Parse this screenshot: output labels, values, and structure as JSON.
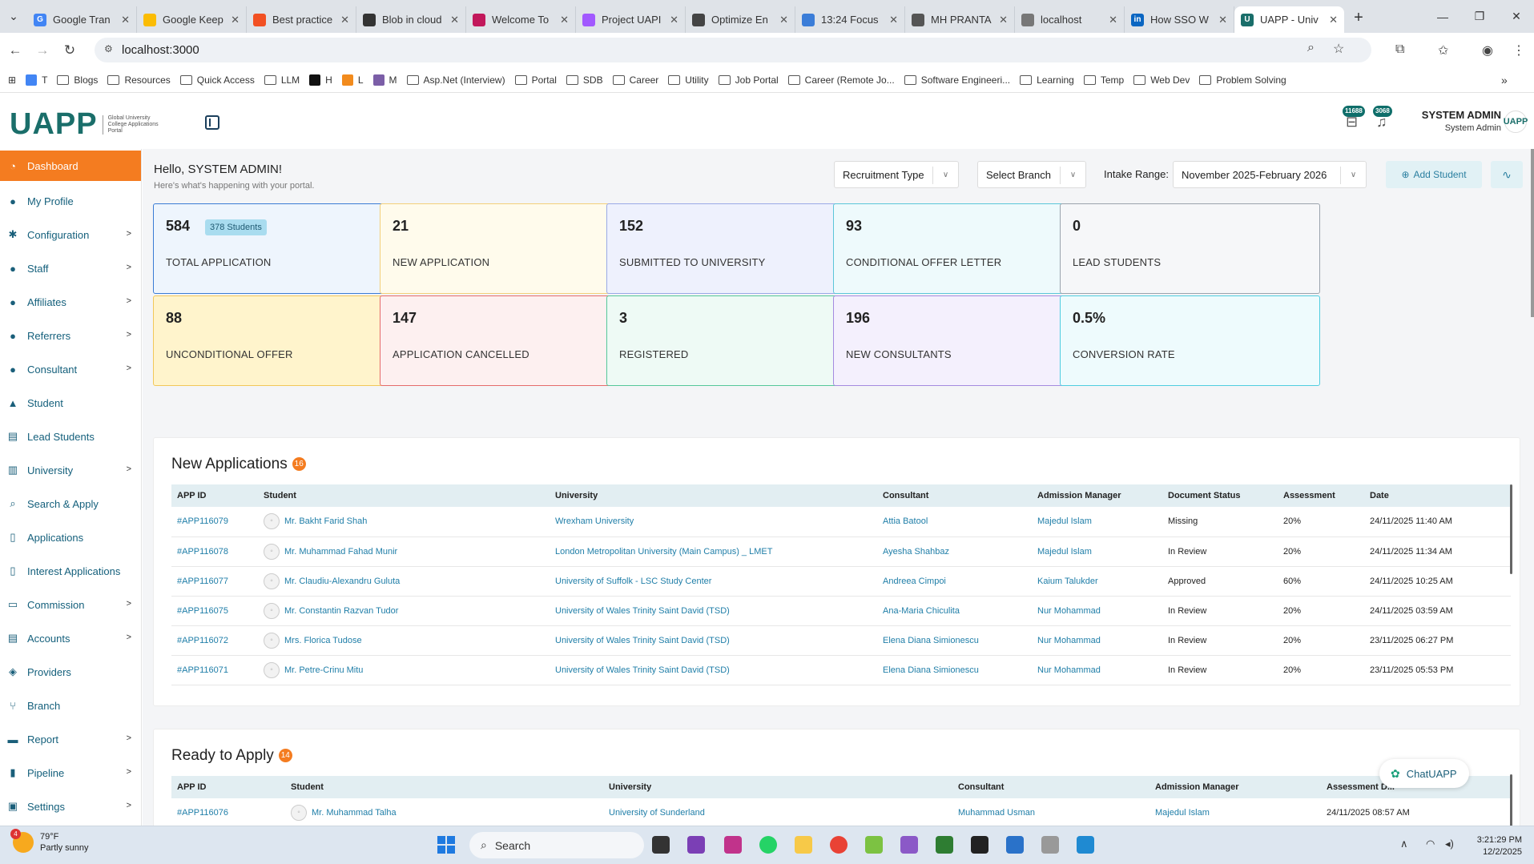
{
  "browser": {
    "tabs": [
      {
        "label": "Google Tran",
        "color": "#4285f4",
        "glyph": "G"
      },
      {
        "label": "Google Keep",
        "color": "#fbbc04",
        "glyph": ""
      },
      {
        "label": "Best practice",
        "color": "#f25022",
        "glyph": ""
      },
      {
        "label": "Blob in cloud",
        "color": "#333333",
        "glyph": ""
      },
      {
        "label": "Welcome To",
        "color": "#c2185b",
        "glyph": ""
      },
      {
        "label": "Project UAPI",
        "color": "#a259ff",
        "glyph": ""
      },
      {
        "label": "Optimize En",
        "color": "#444444",
        "glyph": ""
      },
      {
        "label": "13:24 Focus",
        "color": "#3b7dd8",
        "glyph": ""
      },
      {
        "label": "MH PRANTA",
        "color": "#555555",
        "glyph": ""
      },
      {
        "label": "localhost",
        "color": "#777777",
        "glyph": ""
      },
      {
        "label": "How SSO W",
        "color": "#0a66c2",
        "glyph": "in"
      },
      {
        "label": "UAPP - Univ",
        "color": "#1a6e6a",
        "glyph": "U"
      }
    ],
    "address": "localhost:3000",
    "bookmarks": [
      {
        "label": "T",
        "type": "site",
        "color": "#4285f4"
      },
      {
        "label": "Blogs",
        "type": "folder"
      },
      {
        "label": "Resources",
        "type": "folder"
      },
      {
        "label": "Quick Access",
        "type": "folder"
      },
      {
        "label": "LLM",
        "type": "folder"
      },
      {
        "label": "H",
        "type": "site",
        "color": "#111111"
      },
      {
        "label": "L",
        "type": "site",
        "color": "#f28b1d"
      },
      {
        "label": "M",
        "type": "site",
        "color": "#7b5ea7"
      },
      {
        "label": "Asp.Net (Interview)",
        "type": "folder"
      },
      {
        "label": "Portal",
        "type": "folder"
      },
      {
        "label": "SDB",
        "type": "folder"
      },
      {
        "label": "Career",
        "type": "folder"
      },
      {
        "label": "Utility",
        "type": "folder"
      },
      {
        "label": "Job Portal",
        "type": "folder"
      },
      {
        "label": "Career (Remote Jo...",
        "type": "folder"
      },
      {
        "label": "Software Engineeri...",
        "type": "folder"
      },
      {
        "label": "Learning",
        "type": "folder"
      },
      {
        "label": "Temp",
        "type": "folder"
      },
      {
        "label": "Web Dev",
        "type": "folder"
      },
      {
        "label": "Problem Solving",
        "type": "folder"
      }
    ]
  },
  "header": {
    "logo_text": "UAPP",
    "logo_sub": "Global University College Applications Portal",
    "badge1": "11688",
    "badge2": "3068",
    "user_name": "SYSTEM ADMIN",
    "user_role": "System Admin",
    "avatar_text": "UAPP"
  },
  "sidebar": {
    "items": [
      {
        "label": "Dashboard",
        "icon": "dashboard-icon",
        "glyph": "◔",
        "chevron": false,
        "active": true
      },
      {
        "label": "My Profile",
        "icon": "user-icon",
        "glyph": "●",
        "chevron": false
      },
      {
        "label": "Configuration",
        "icon": "gear-icon",
        "glyph": "✱",
        "chevron": true
      },
      {
        "label": "Staff",
        "icon": "users-icon",
        "glyph": "●",
        "chevron": true
      },
      {
        "label": "Affiliates",
        "icon": "user-plus-icon",
        "glyph": "●",
        "chevron": true
      },
      {
        "label": "Referrers",
        "icon": "user-share-icon",
        "glyph": "●",
        "chevron": true
      },
      {
        "label": "Consultant",
        "icon": "user-tie-icon",
        "glyph": "●",
        "chevron": true
      },
      {
        "label": "Student",
        "icon": "graduation-cap-icon",
        "glyph": "▲",
        "chevron": false
      },
      {
        "label": "Lead Students",
        "icon": "user-list-icon",
        "glyph": "▤",
        "chevron": false
      },
      {
        "label": "University",
        "icon": "university-icon",
        "glyph": "▥",
        "chevron": true
      },
      {
        "label": "Search & Apply",
        "icon": "search-icon",
        "glyph": "⌕",
        "chevron": false
      },
      {
        "label": "Applications",
        "icon": "file-icon",
        "glyph": "▯",
        "chevron": false
      },
      {
        "label": "Interest Applications",
        "icon": "file-icon",
        "glyph": "▯",
        "chevron": false
      },
      {
        "label": "Commission",
        "icon": "money-icon",
        "glyph": "▭",
        "chevron": true
      },
      {
        "label": "Accounts",
        "icon": "accounts-icon",
        "glyph": "▤",
        "chevron": true
      },
      {
        "label": "Providers",
        "icon": "handshake-icon",
        "glyph": "◈",
        "chevron": false
      },
      {
        "label": "Branch",
        "icon": "branch-icon",
        "glyph": "⑂",
        "chevron": false
      },
      {
        "label": "Report",
        "icon": "report-icon",
        "glyph": "▬",
        "chevron": true
      },
      {
        "label": "Pipeline",
        "icon": "bar-chart-icon",
        "glyph": "▮",
        "chevron": true
      },
      {
        "label": "Settings",
        "icon": "settings-icon",
        "glyph": "▣",
        "chevron": true
      }
    ]
  },
  "main": {
    "greeting": "Hello, SYSTEM ADMIN!",
    "greeting_sub": "Here's what's happening with your portal.",
    "filters": {
      "recruitment_type": "Recruitment Type",
      "branch": "Select Branch",
      "intake_label": "Intake Range:",
      "intake_value": "November 2025-February 2026",
      "add_student": "Add Student"
    },
    "stats": [
      {
        "value": "584",
        "label": "TOTAL APPLICATION",
        "badge": "378 Students",
        "bg": "#eef5fd",
        "border": "#3a7bd5"
      },
      {
        "value": "21",
        "label": "NEW APPLICATION",
        "bg": "#fffbec",
        "border": "#f3cf7a"
      },
      {
        "value": "152",
        "label": "SUBMITTED TO UNIVERSITY",
        "bg": "#eef1fd",
        "border": "#9aa9e6"
      },
      {
        "value": "93",
        "label": "CONDITIONAL OFFER LETTER",
        "bg": "#eefafc",
        "border": "#5bc6d9"
      },
      {
        "value": "0",
        "label": "LEAD STUDENTS",
        "bg": "#f6f7f9",
        "border": "#9aa3ad"
      },
      {
        "value": "88",
        "label": "UNCONDITIONAL OFFER",
        "bg": "#fff4cc",
        "border": "#f2c759"
      },
      {
        "value": "147",
        "label": "APPLICATION CANCELLED",
        "bg": "#fdf0f0",
        "border": "#e56b6b"
      },
      {
        "value": "3",
        "label": "REGISTERED",
        "bg": "#eefaf5",
        "border": "#55c79a"
      },
      {
        "value": "196",
        "label": "NEW CONSULTANTS",
        "bg": "#f4f0fd",
        "border": "#a48be0"
      },
      {
        "value": "0.5%",
        "label": "CONVERSION RATE",
        "bg": "#eefbfd",
        "border": "#4fcde0"
      }
    ],
    "new_applications": {
      "title": "New Applications",
      "count": "16",
      "columns": [
        "APP ID",
        "Student",
        "University",
        "Consultant",
        "Admission Manager",
        "Document Status",
        "Assessment",
        "Date"
      ],
      "rows": [
        {
          "id": "#APP116079",
          "student": "Mr. Bakht Farid Shah",
          "university": "Wrexham University",
          "consultant": "Attia Batool",
          "manager": "Majedul Islam",
          "doc": "Missing",
          "assessment": "20%",
          "date": "24/11/2025 11:40 AM"
        },
        {
          "id": "#APP116078",
          "student": "Mr. Muhammad Fahad Munir",
          "university": "London Metropolitan University (Main Campus) _ LMET",
          "consultant": "Ayesha Shahbaz",
          "manager": "Majedul Islam",
          "doc": "In Review",
          "assessment": "20%",
          "date": "24/11/2025 11:34 AM"
        },
        {
          "id": "#APP116077",
          "student": "Mr. Claudiu-Alexandru Guluta",
          "university": "University of Suffolk - LSC Study Center",
          "consultant": "Andreea Cimpoi",
          "manager": "Kaium Talukder",
          "doc": "Approved",
          "assessment": "60%",
          "date": "24/11/2025 10:25 AM"
        },
        {
          "id": "#APP116075",
          "student": "Mr. Constantin Razvan Tudor",
          "university": "University of Wales Trinity Saint David (TSD)",
          "consultant": "Ana-Maria Chiculita",
          "manager": "Nur Mohammad",
          "doc": "In Review",
          "assessment": "20%",
          "date": "24/11/2025 03:59 AM"
        },
        {
          "id": "#APP116072",
          "student": "Mrs. Florica Tudose",
          "university": "University of Wales Trinity Saint David (TSD)",
          "consultant": "Elena Diana Simionescu",
          "manager": "Nur Mohammad",
          "doc": "In Review",
          "assessment": "20%",
          "date": "23/11/2025 06:27 PM"
        },
        {
          "id": "#APP116071",
          "student": "Mr. Petre-Crinu Mitu",
          "university": "University of Wales Trinity Saint David (TSD)",
          "consultant": "Elena Diana Simionescu",
          "manager": "Nur Mohammad",
          "doc": "In Review",
          "assessment": "20%",
          "date": "23/11/2025 05:53 PM"
        }
      ]
    },
    "ready_to_apply": {
      "title": "Ready to Apply",
      "count": "14",
      "columns": [
        "APP ID",
        "Student",
        "University",
        "Consultant",
        "Admission Manager",
        "Assessment D..."
      ],
      "rows": [
        {
          "id": "#APP116076",
          "student": "Mr. Muhammad Talha",
          "university": "University of Sunderland",
          "consultant": "Muhammad Usman",
          "manager": "Majedul Islam",
          "date": "24/11/2025 08:57 AM"
        }
      ]
    },
    "chat_label": "ChatUAPP"
  },
  "taskbar": {
    "weather_temp": "79°F",
    "weather_desc": "Partly sunny",
    "weather_badge": "4",
    "search_placeholder": "Search",
    "time": "3:21:29 PM",
    "date": "12/2/2025"
  }
}
